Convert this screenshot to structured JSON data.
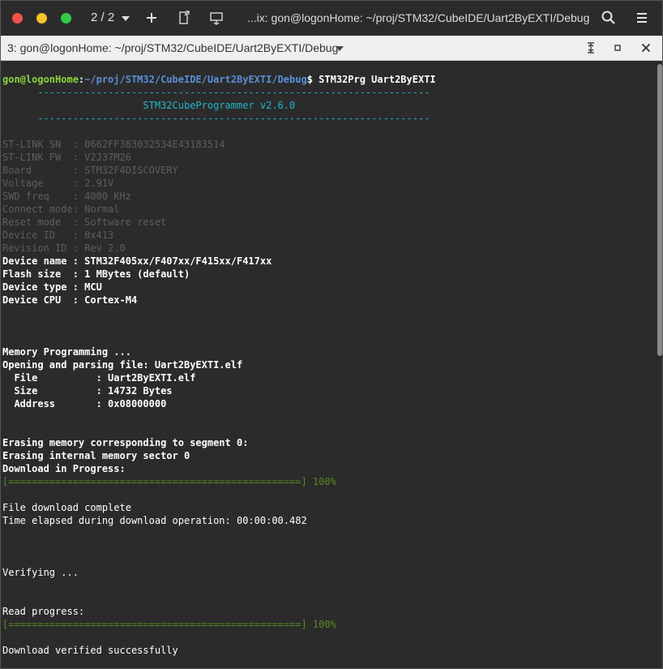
{
  "titlebar": {
    "tab_counter": "2 / 2",
    "title": "...ix: gon@logonHome: ~/proj/STM32/CubeIDE/Uart2ByEXTI/Debug"
  },
  "tabbar": {
    "label": "3: gon@logonHome: ~/proj/STM32/CubeIDE/Uart2ByEXTI/Debug"
  },
  "icons": {
    "close": "close-icon",
    "minimize": "minimize-icon",
    "maximize": "maximize-icon",
    "new_tab": "plus-icon",
    "detach": "detach-tab-icon",
    "send": "send-input-icon",
    "search": "search-icon",
    "menu": "hamburger-menu-icon"
  },
  "terminal": {
    "prompt_user": "gon@logonHome",
    "prompt_sep": ":",
    "prompt_path": "~/proj/STM32/CubeIDE/Uart2ByEXTI/Debug",
    "prompt_cmd": "$ STM32Prg Uart2ByEXTI",
    "rule_line": "      -------------------------------------------------------------------",
    "banner": "                        STM32CubeProgrammer v2.6.0",
    "info_dim": [
      "ST-LINK SN  : 0662FF383032534E43183514",
      "ST-LINK FW  : V2J37M26",
      "Board       : STM32F4DISCOVERY",
      "Voltage     : 2.91V",
      "SWD freq    : 4000 KHz",
      "Connect mode: Normal",
      "Reset mode  : Software reset",
      "Device ID   : 0x413",
      "Revision ID : Rev 2.0"
    ],
    "info_bright": [
      "Device name : STM32F405xx/F407xx/F415xx/F417xx",
      "Flash size  : 1 MBytes (default)",
      "Device type : MCU",
      "Device CPU  : Cortex-M4"
    ],
    "mem_prog": "Memory Programming ...",
    "opening": "Opening and parsing file: Uart2ByEXTI.elf",
    "file_line": "  File          : Uart2ByEXTI.elf",
    "size_line": "  Size          : 14732 Bytes",
    "addr_line": "  Address       : 0x08000000",
    "erasing1": "Erasing memory corresponding to segment 0:",
    "erasing2": "Erasing internal memory sector 0",
    "dl_progress": "Download in Progress:",
    "progress_bar": "[==================================================] 100%",
    "dl_complete": "File download complete",
    "time_elapsed": "Time elapsed during download operation: 00:00:00.482",
    "verifying": "Verifying ...",
    "read_progress": "Read progress:",
    "progress_bar2": "[==================================================] 100%",
    "verified": "Download verified successfully"
  }
}
